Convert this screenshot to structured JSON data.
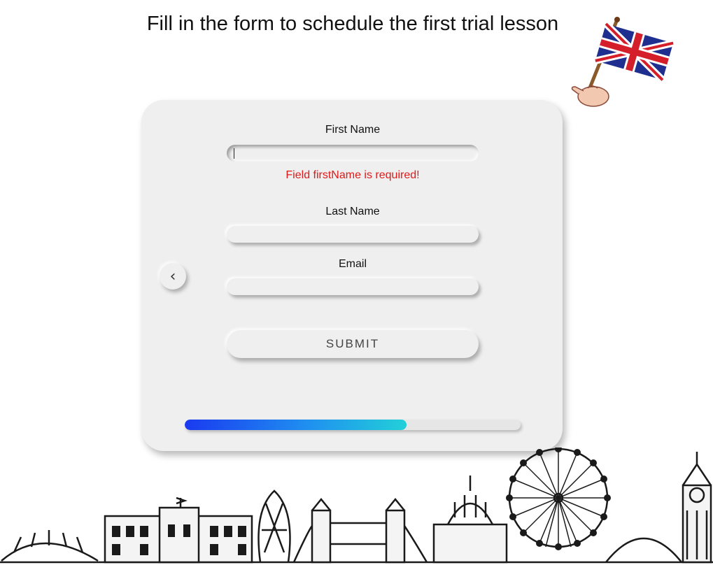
{
  "page": {
    "title": "Fill in the form to schedule the first trial lesson"
  },
  "form": {
    "first_name_label": "First Name",
    "first_name_value": "",
    "first_name_error": "Field firstName is required!",
    "last_name_label": "Last Name",
    "last_name_value": "",
    "email_label": "Email",
    "email_value": "",
    "submit_label": "SUBMIT",
    "back_icon": "chevron-left-icon",
    "back_glyph": "‹"
  },
  "progress": {
    "fraction": 0.66,
    "colors": [
      "#1a3af0",
      "#22d0d8"
    ]
  },
  "decorations": {
    "flag": "uk-flag-icon",
    "skyline": "london-skyline-illustration"
  },
  "colors": {
    "error": "#e01919",
    "card": "#efefef"
  }
}
